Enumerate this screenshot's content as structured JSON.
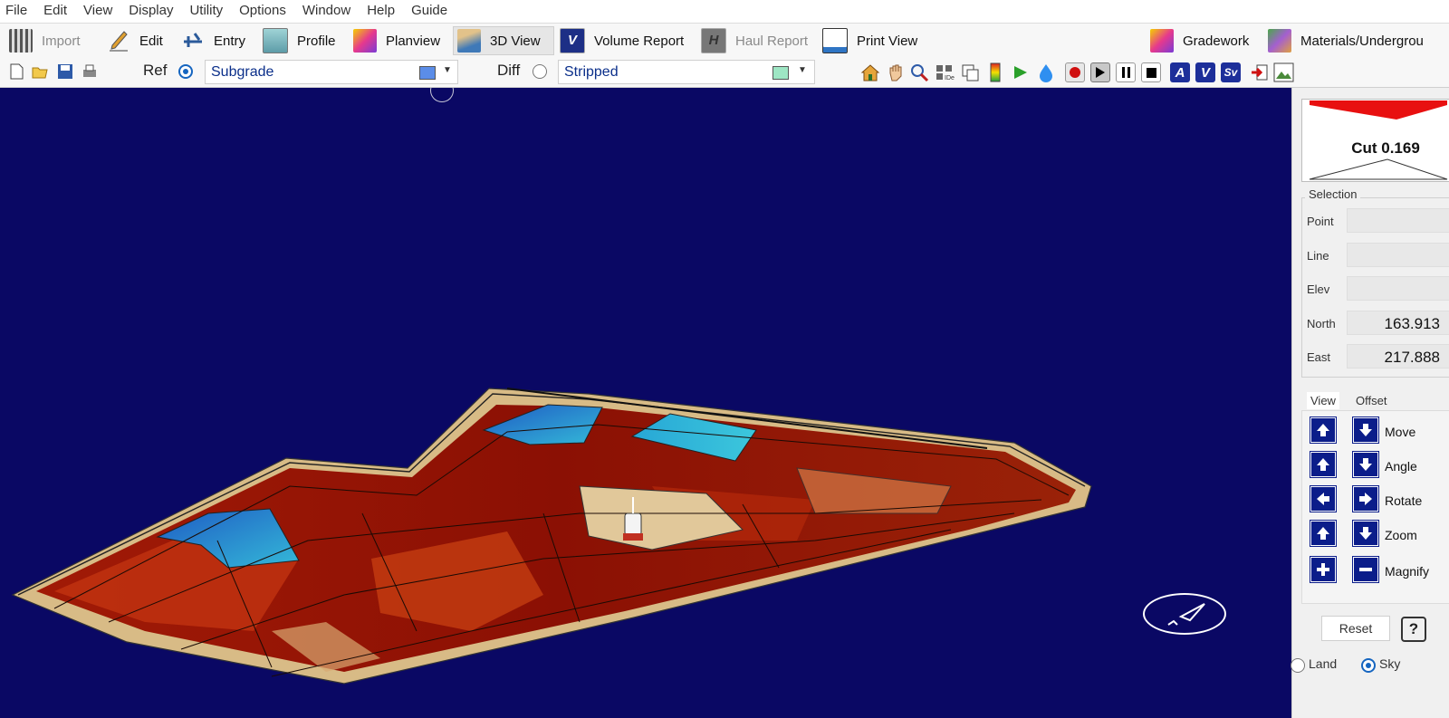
{
  "menu": [
    "File",
    "Edit",
    "View",
    "Display",
    "Utility",
    "Options",
    "Window",
    "Help",
    "Guide"
  ],
  "toolbar": {
    "buttons": [
      {
        "label": "Import",
        "icon": "import-grid-icon",
        "state": "disabled"
      },
      {
        "label": "Edit",
        "icon": "pencil-icon",
        "state": "normal"
      },
      {
        "label": "Entry",
        "icon": "entry-icon",
        "state": "normal"
      },
      {
        "label": "Profile",
        "icon": "profile-icon",
        "state": "normal"
      },
      {
        "label": "Planview",
        "icon": "planview-icon",
        "state": "normal"
      },
      {
        "label": "3D View",
        "icon": "3d-view-icon",
        "state": "active"
      },
      {
        "label": "Volume Report",
        "icon": "volume-report-icon",
        "state": "normal"
      },
      {
        "label": "Haul Report",
        "icon": "haul-report-icon",
        "state": "disabled"
      },
      {
        "label": "Print View",
        "icon": "print-view-icon",
        "state": "normal"
      },
      {
        "label": "Gradework",
        "icon": "gradework-icon",
        "state": "normal"
      },
      {
        "label": "Materials/Undergrou",
        "icon": "materials-icon",
        "state": "normal"
      }
    ]
  },
  "surfacebar": {
    "ref_label": "Ref",
    "ref_selected": true,
    "ref_surface": "Subgrade",
    "ref_color": "#5b8de8",
    "diff_label": "Diff",
    "diff_selected": false,
    "diff_surface": "Stripped",
    "diff_color": "#9ee6c4",
    "tool_icons": [
      "home-icon",
      "pan-hand-icon",
      "zoom-window-icon",
      "grid-icon",
      "layers-icon",
      "color-scale-icon",
      "flag-icon",
      "water-drop-icon"
    ],
    "playback_icons": [
      "record-icon",
      "play-icon",
      "pause-icon",
      "stop-icon"
    ],
    "letter_buttons": [
      "A",
      "V",
      "Sv"
    ],
    "extra_icons": [
      "exit-icon",
      "image-icon"
    ]
  },
  "panel": {
    "cut_label": "Cut 0.169",
    "selection": {
      "title": "Selection",
      "fields": [
        {
          "label": "Point",
          "value": ""
        },
        {
          "label": "Line",
          "value": ""
        },
        {
          "label": "Elev",
          "value": ""
        },
        {
          "label": "North",
          "value": "163.913"
        },
        {
          "label": "East",
          "value": "217.888"
        }
      ]
    },
    "tabs": [
      "View",
      "Offset"
    ],
    "nav": [
      {
        "label": "Move",
        "left": "up",
        "right": "down"
      },
      {
        "label": "Angle",
        "left": "up",
        "right": "down"
      },
      {
        "label": "Rotate",
        "left": "left",
        "right": "right"
      },
      {
        "label": "Zoom",
        "left": "up",
        "right": "down"
      },
      {
        "label": "Magnify",
        "left": "plus",
        "right": "minus"
      }
    ],
    "reset_label": "Reset",
    "help_label": "?",
    "view_modes": [
      {
        "label": "Land",
        "selected": false
      },
      {
        "label": "Sky",
        "selected": true
      }
    ]
  },
  "colors": {
    "background_3d": "#0a0864",
    "cut_deep": "#8b1004",
    "cut_mid": "#c23310",
    "fill_blue": "#2e6fd0",
    "fill_cyan": "#34b9d8",
    "pad_tan": "#d8bb86",
    "nav_button": "#0b1d8a"
  }
}
